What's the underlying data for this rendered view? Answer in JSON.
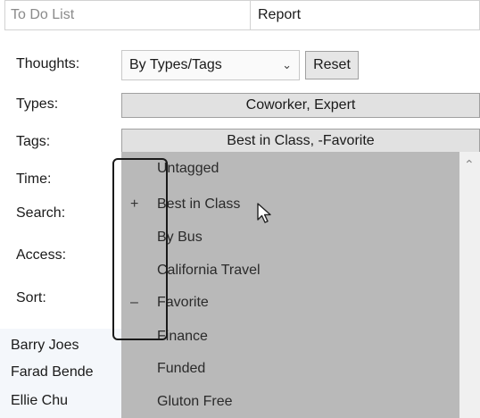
{
  "tabs": {
    "todo": "To Do List",
    "report": "Report"
  },
  "labels": {
    "thoughts": "Thoughts:",
    "types": "Types:",
    "tags": "Tags:",
    "time": "Time:",
    "search": "Search:",
    "access": "Access:",
    "sort": "Sort:"
  },
  "thoughts_select": {
    "value": "By Types/Tags"
  },
  "reset_label": "Reset",
  "types_value": "Coworker, Expert",
  "tags_value": "Best in Class, -Favorite",
  "dropdown": {
    "items": [
      {
        "label": "Untagged",
        "mark": ""
      },
      {
        "label": "Best in Class",
        "mark": "+"
      },
      {
        "label": "By Bus",
        "mark": ""
      },
      {
        "label": "California Travel",
        "mark": ""
      },
      {
        "label": "Favorite",
        "mark": "–"
      },
      {
        "label": "Finance",
        "mark": ""
      },
      {
        "label": "Funded",
        "mark": ""
      },
      {
        "label": "Gluton Free",
        "mark": ""
      }
    ]
  },
  "names": [
    "Barry Joes",
    "Farad Bende",
    "Ellie Chu"
  ],
  "icons": {
    "scroll_up": "chevron-up-icon",
    "cursor": "mouse-pointer-icon"
  }
}
